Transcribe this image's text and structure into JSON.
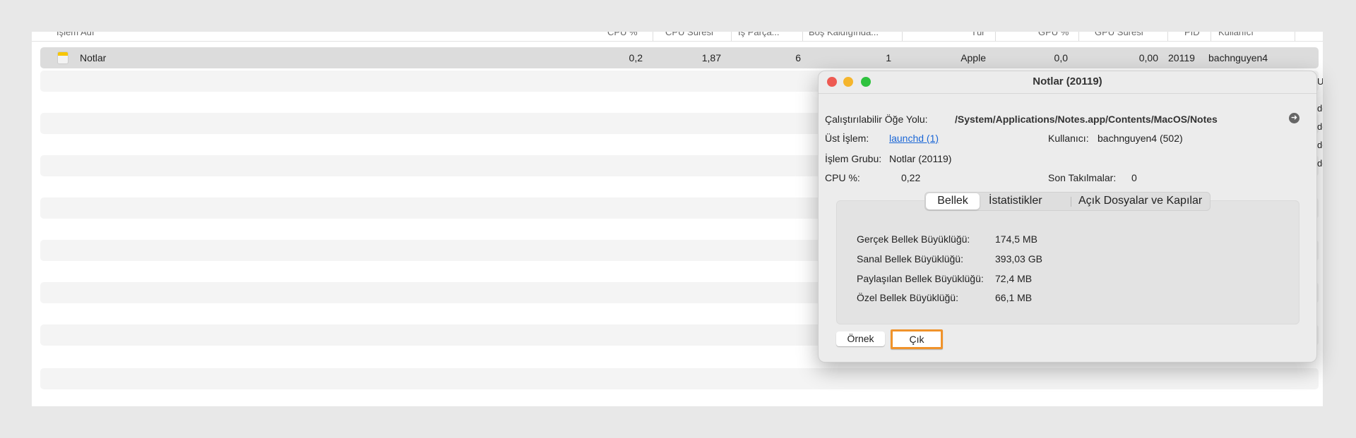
{
  "table": {
    "headers": [
      "İşlem Adı",
      "CPU %",
      "CPU Süresi",
      "İş Parça...",
      "Boş Kaldığında...",
      "Tür",
      "GPU %",
      "GPU Süresi",
      "PID",
      "Kullanıcı"
    ],
    "row": {
      "name": "Notlar",
      "cpu": "0,2",
      "cpu_time": "1,87",
      "threads": "6",
      "idle_wakeups": "1",
      "kind": "Apple",
      "gpu": "0,0",
      "gpu_time": "0,00",
      "pid": "20119",
      "user": "bachnguyen4"
    },
    "partial_right": [
      "U",
      "de",
      "de",
      "de",
      "de"
    ]
  },
  "dialog": {
    "title": "Notlar (20119)",
    "exec_label": "Çalıştırılabilir Öğe Yolu:",
    "exec_value": "/System/Applications/Notes.app/Contents/MacOS/Notes",
    "parent_label": "Üst İşlem:",
    "parent_value": "launchd (1)",
    "user_label": "Kullanıcı:",
    "user_value": "bachnguyen4 (502)",
    "group_label": "İşlem Grubu:",
    "group_value": "Notlar (20119)",
    "cpu_label": "CPU %:",
    "cpu_value": "0,22",
    "hangs_label": "Son Takılmalar:",
    "hangs_value": "0",
    "tabs": [
      "Bellek",
      "İstatistikler",
      "Açık Dosyalar ve Kapılar"
    ],
    "memory": [
      {
        "label": "Gerçek Bellek Büyüklüğü:",
        "value": "174,5 MB"
      },
      {
        "label": "Sanal Bellek Büyüklüğü:",
        "value": "393,03 GB"
      },
      {
        "label": "Paylaşılan Bellek Büyüklüğü:",
        "value": "72,4 MB"
      },
      {
        "label": "Özel Bellek Büyüklüğü:",
        "value": "66,1 MB"
      }
    ],
    "sample_button": "Örnek",
    "quit_button": "Çık"
  },
  "colors": {
    "highlight": "#f0932b",
    "link": "#1a66d6"
  }
}
